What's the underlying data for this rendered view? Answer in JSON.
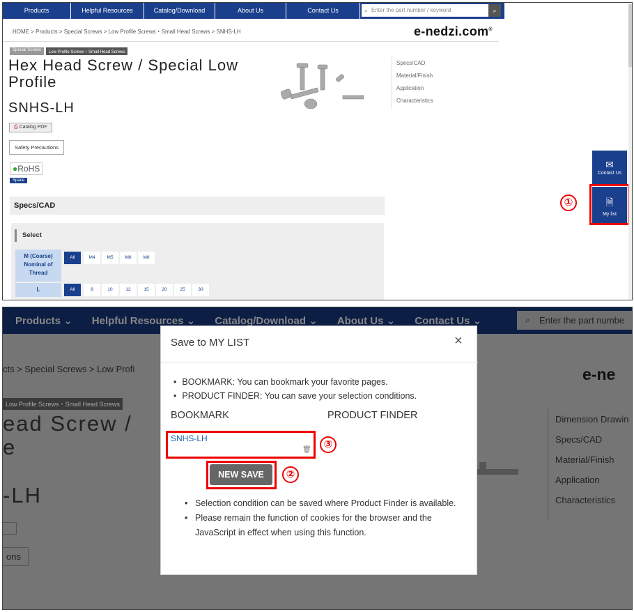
{
  "top": {
    "nav": [
      "Products",
      "Helpful Resources",
      "Catalog/Download",
      "About Us",
      "Contact Us"
    ],
    "search_placeholder": "Enter the part number / keyword",
    "breadcrumb": "HOME  >  Products  >  Special Screws  >  Low Profile Screws・Small Head Screws  >  SNHS-LH",
    "logo": "e-nedzi.com",
    "logo_mark": "®",
    "tags": [
      "Special Screws",
      "Low Profile Screws・Small Head Screws"
    ],
    "title": "Hex Head Screw / Special Low Profile",
    "sku": "SNHS-LH",
    "side_links": [
      "Specs/CAD",
      "Material/Finish",
      "Application",
      "Characteristics"
    ],
    "catalog_pdf": "Catalog PDF",
    "safety": "Safety Precautions",
    "rohs": "RoHS",
    "space": "Space",
    "specs_heading": "Specs/CAD",
    "select_heading": "Select",
    "row1_label": "M (Coarse) Nominal of Thread",
    "row1_chips": [
      "All",
      "M4",
      "M5",
      "M6",
      "M8"
    ],
    "row2_label": "L",
    "row2_chips": [
      "All",
      "8",
      "10",
      "12",
      "15",
      "20",
      "25",
      "30"
    ],
    "contact_fab": "Contact Us",
    "mylist_fab": "My list",
    "marker1": "①"
  },
  "bottom": {
    "nav": [
      "Products",
      "Helpful Resources",
      "Catalog/Download",
      "About Us",
      "Contact Us"
    ],
    "search_placeholder": "Enter the part numbe",
    "breadcrumb": "cts  >  Special Screws  >  Low Profi",
    "logo": "e-ne",
    "tag": "Low Profile Screws・Small Head Screws",
    "title_l1": "ead Screw /",
    "title_l2": "e",
    "sku": "-LH",
    "btn_text": "ons",
    "side_links": [
      "Dimension Drawin",
      "Specs/CAD",
      "Material/Finish",
      "Application",
      "Characteristics"
    ],
    "modal": {
      "title": "Save to MY LIST",
      "bullets": [
        "BOOKMARK: You can bookmark your favorite pages.",
        "PRODUCT FINDER: You can save your selection conditions."
      ],
      "bookmark_heading": "BOOKMARK",
      "finder_heading": "PRODUCT FINDER",
      "bookmark_item": "SNHS-LH",
      "new_save": "NEW SAVE",
      "notes": [
        "Selection condition can be saved where Product Finder is available.",
        "Please remain the function of cookies for the browser and the JavaScript in effect when using this function."
      ]
    },
    "marker2": "②",
    "marker3": "③"
  }
}
